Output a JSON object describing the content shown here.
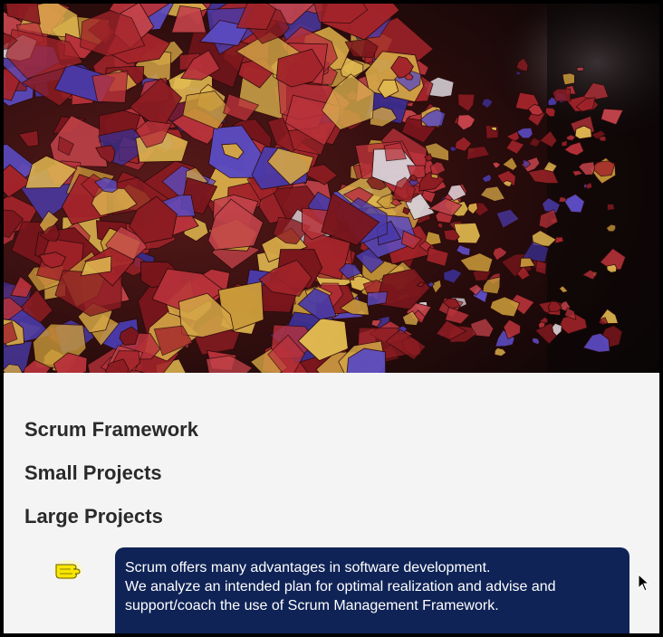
{
  "hero": {
    "image_description_icon": "shattered-fragments-image"
  },
  "nav": {
    "items": [
      {
        "label": "Scrum Framework"
      },
      {
        "label": "Small Projects"
      },
      {
        "label": "Large Projects"
      }
    ]
  },
  "info": {
    "pointer_icon": "hand-pointer-icon",
    "lines": [
      "Scrum offers many advantages in software development.",
      "We analyze an intended plan for optimal realization and advise and",
      "support/coach the use of Scrum Management Framework."
    ]
  },
  "colors": {
    "info_box_bg": "#0f2356",
    "text_dark": "#2a2a2a",
    "pointer_yellow": "#f7e600"
  }
}
